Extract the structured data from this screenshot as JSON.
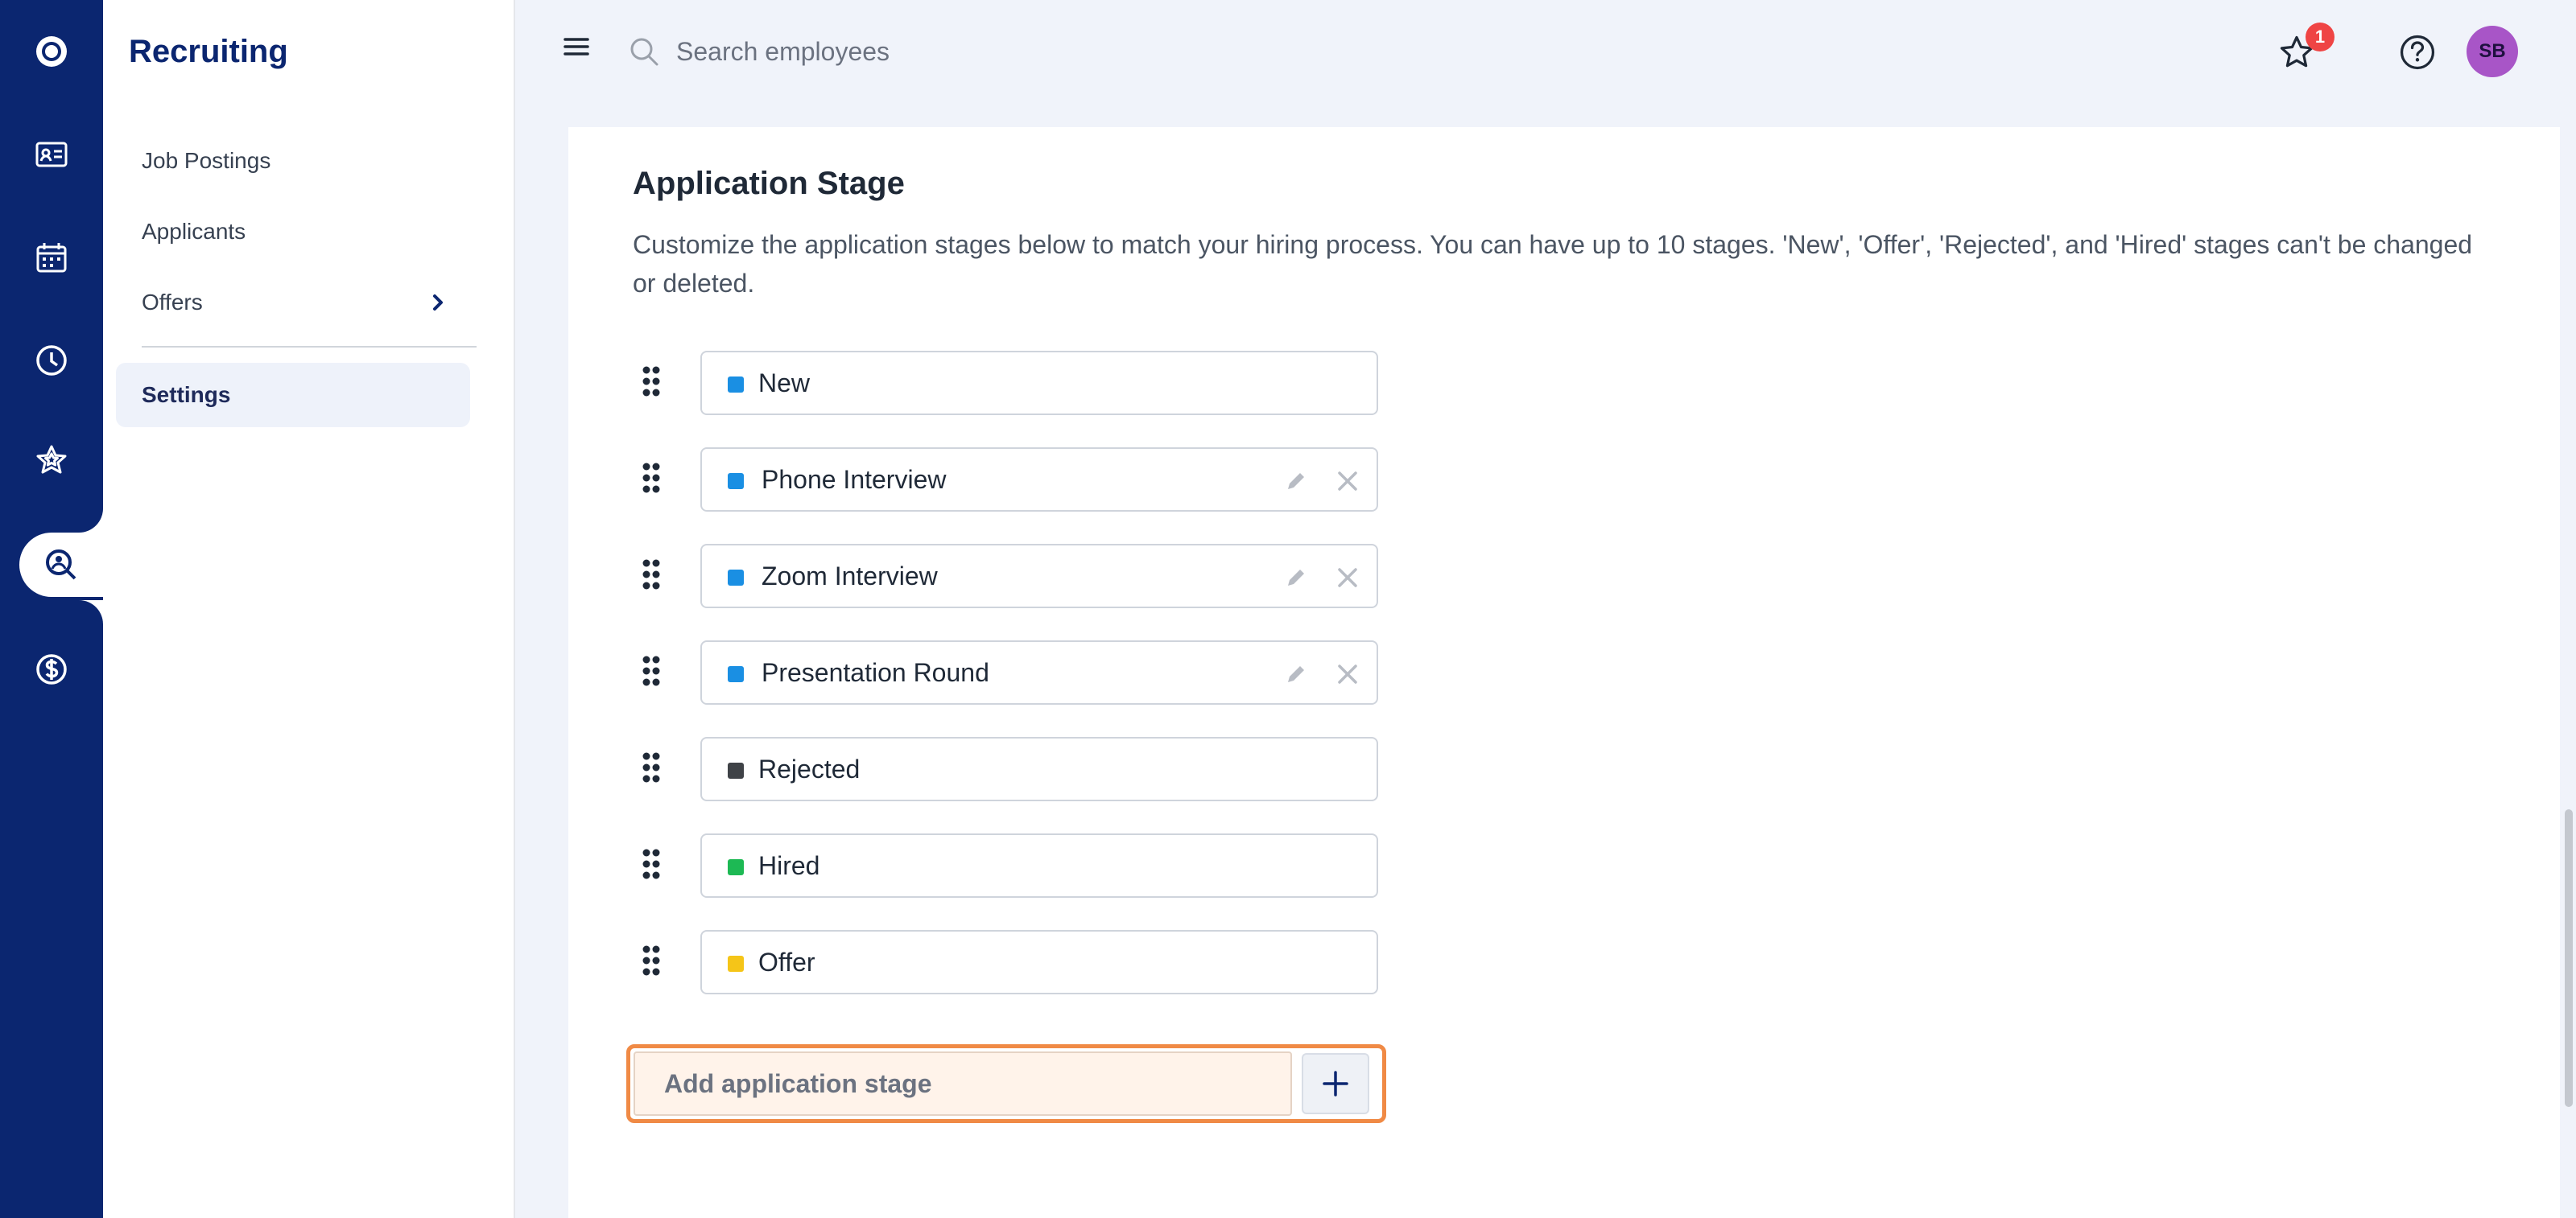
{
  "app": {
    "section_title": "Recruiting"
  },
  "rail": {
    "items": [
      {
        "icon": "logo-circle-icon"
      },
      {
        "icon": "id-card-icon"
      },
      {
        "icon": "calendar-icon"
      },
      {
        "icon": "clock-icon"
      },
      {
        "icon": "star-icon"
      },
      {
        "icon": "search-person-icon",
        "active": true
      },
      {
        "icon": "dollar-circle-icon"
      }
    ]
  },
  "subnav": {
    "items": [
      {
        "label": "Job Postings"
      },
      {
        "label": "Applicants"
      },
      {
        "label": "Offers",
        "has_chevron": true
      },
      {
        "label": "Settings",
        "active": true
      }
    ]
  },
  "topbar": {
    "search_placeholder": "Search employees",
    "notification_count": "1",
    "avatar_initials": "SB"
  },
  "stages": {
    "title": "Application Stage",
    "description": "Customize the application stages below to match your hiring process. You can have up to 10 stages. 'New', 'Offer', 'Rejected', and 'Hired' stages can't be changed or deleted.",
    "items": [
      {
        "label": "New",
        "color": "#1a8fe3",
        "editable": false
      },
      {
        "label": "Phone Interview",
        "color": "#1a8fe3",
        "editable": true
      },
      {
        "label": "Zoom Interview",
        "color": "#1a8fe3",
        "editable": true
      },
      {
        "label": "Presentation Round",
        "color": "#1a8fe3",
        "editable": true
      },
      {
        "label": "Rejected",
        "color": "#3f4247",
        "editable": false
      },
      {
        "label": "Hired",
        "color": "#1db954",
        "editable": false
      },
      {
        "label": "Offer",
        "color": "#f5c518",
        "editable": false
      }
    ],
    "add_placeholder": "Add application stage"
  },
  "colors": {
    "rail_bg": "#0b2670",
    "accent_focus": "#f08a45",
    "avatar_bg": "#a855c7",
    "badge_bg": "#ef4444"
  }
}
